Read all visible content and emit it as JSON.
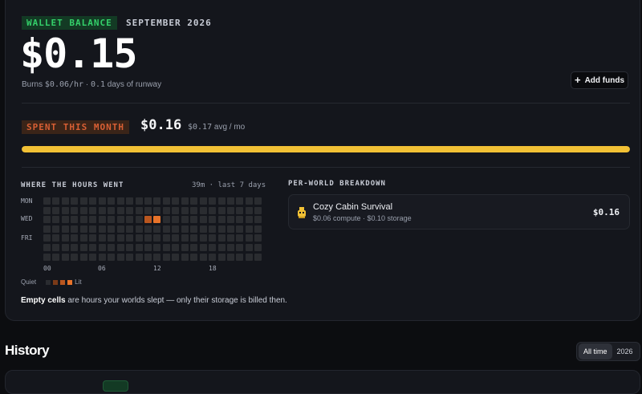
{
  "wallet": {
    "tag": "WALLET BALANCE",
    "month": "SEPTEMBER 2026",
    "balance": "$0.15",
    "burn_prefix": "Burns ",
    "burn_rate": "$0.06/hr",
    "burn_sep": " · ",
    "runway_days": "0.1",
    "runway_suffix": " days of runway",
    "add_funds_label": "Add funds",
    "add_funds_icon": "plus-icon"
  },
  "spending": {
    "tag": "SPENT THIS MONTH",
    "amount": "$0.16",
    "avg_amount": "$0.17",
    "avg_suffix": " avg / mo",
    "progress_fraction": 1.0,
    "bar_color": "#f2c135"
  },
  "hours": {
    "title": "WHERE THE HOURS WENT",
    "meta": "39m · last 7 days",
    "row_labels": [
      "MON",
      "",
      "WED",
      "",
      "FRI",
      "",
      ""
    ],
    "col_labels": [
      "00",
      "06",
      "12",
      "18"
    ],
    "rows": 7,
    "cols": 24,
    "active_cells": [
      {
        "day": 2,
        "hour": 11,
        "level": "warm"
      },
      {
        "day": 2,
        "hour": 12,
        "level": "hot"
      }
    ],
    "legend_quiet": "Quiet",
    "legend_lit": "Lit",
    "note_bold": "Empty cells",
    "note_rest": " are hours your worlds slept — only their storage is billed then."
  },
  "breakdown": {
    "title": "PER-WORLD BREAKDOWN",
    "worlds": [
      {
        "name": "Cozy Cabin Survival",
        "detail": "$0.06 compute · $0.10 storage",
        "amount": "$0.16",
        "icon": "world-icon"
      }
    ]
  },
  "history": {
    "title": "History",
    "filters": [
      "All time",
      "2026"
    ],
    "active_filter": "All time"
  },
  "colors": {
    "accent_green": "#34d06a",
    "accent_orange": "#d85f34",
    "accent_yellow": "#f2c135"
  }
}
